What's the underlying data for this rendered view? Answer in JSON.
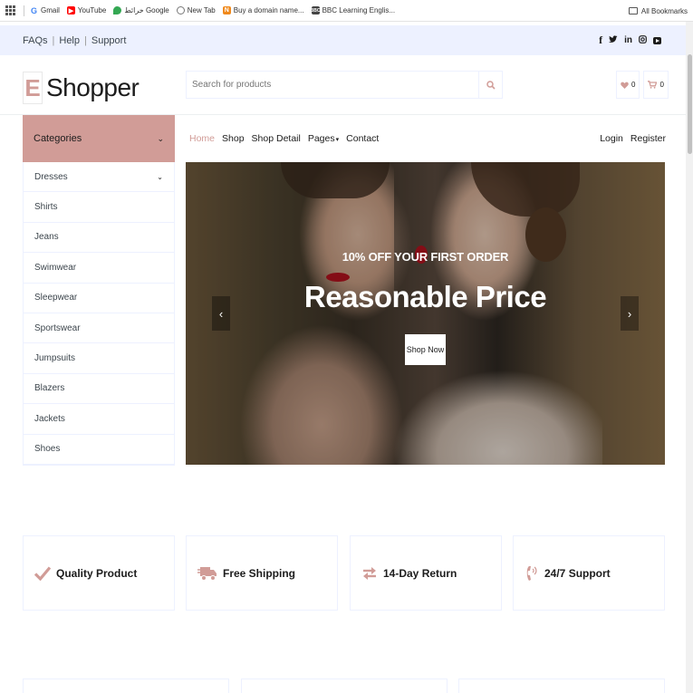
{
  "bookmarks": {
    "items": [
      {
        "label": "Gmail",
        "icon": "google-icon",
        "color": "#4285f4"
      },
      {
        "label": "YouTube",
        "icon": "youtube-icon",
        "color": "#ff0000"
      },
      {
        "label": "خرائط Google",
        "icon": "maps-icon",
        "color": "#34a853"
      },
      {
        "label": "New Tab",
        "icon": "globe-icon",
        "color": "#777777"
      },
      {
        "label": "Buy a domain name...",
        "icon": "domain-icon",
        "color": "#f0891b"
      },
      {
        "label": "BBC Learning Englis...",
        "icon": "bbc-icon",
        "color": "#444444"
      }
    ],
    "all_bookmarks": "All Bookmarks"
  },
  "topbar": {
    "links": [
      "FAQs",
      "Help",
      "Support"
    ],
    "social": [
      "facebook-icon",
      "twitter-icon",
      "linkedin-icon",
      "instagram-icon",
      "youtube-icon"
    ]
  },
  "header": {
    "logo_letter": "E",
    "logo_text": "Shopper",
    "search_placeholder": "Search for products",
    "wishlist_count": "0",
    "cart_count": "0"
  },
  "categories": {
    "title": "Categories",
    "items": [
      "Dresses",
      "Shirts",
      "Jeans",
      "Swimwear",
      "Sleepwear",
      "Sportswear",
      "Jumpsuits",
      "Blazers",
      "Jackets",
      "Shoes"
    ]
  },
  "nav": {
    "links": [
      "Home",
      "Shop",
      "Shop Detail",
      "Pages",
      "Contact"
    ],
    "active": "Home",
    "login": "Login",
    "register": "Register"
  },
  "hero": {
    "subtitle": "10% OFF YOUR FIRST ORDER",
    "title": "Reasonable Price",
    "button": "Shop Now"
  },
  "features": [
    {
      "label": "Quality Product",
      "icon": "check-icon"
    },
    {
      "label": "Free Shipping",
      "icon": "shipping-fast-icon"
    },
    {
      "label": "14-Day Return",
      "icon": "exchange-icon"
    },
    {
      "label": "24/7 Support",
      "icon": "phone-volume-icon"
    }
  ],
  "colors": {
    "accent": "#d19c97",
    "topbar_bg": "#edf1ff",
    "text_dark": "#1c1c1c"
  }
}
